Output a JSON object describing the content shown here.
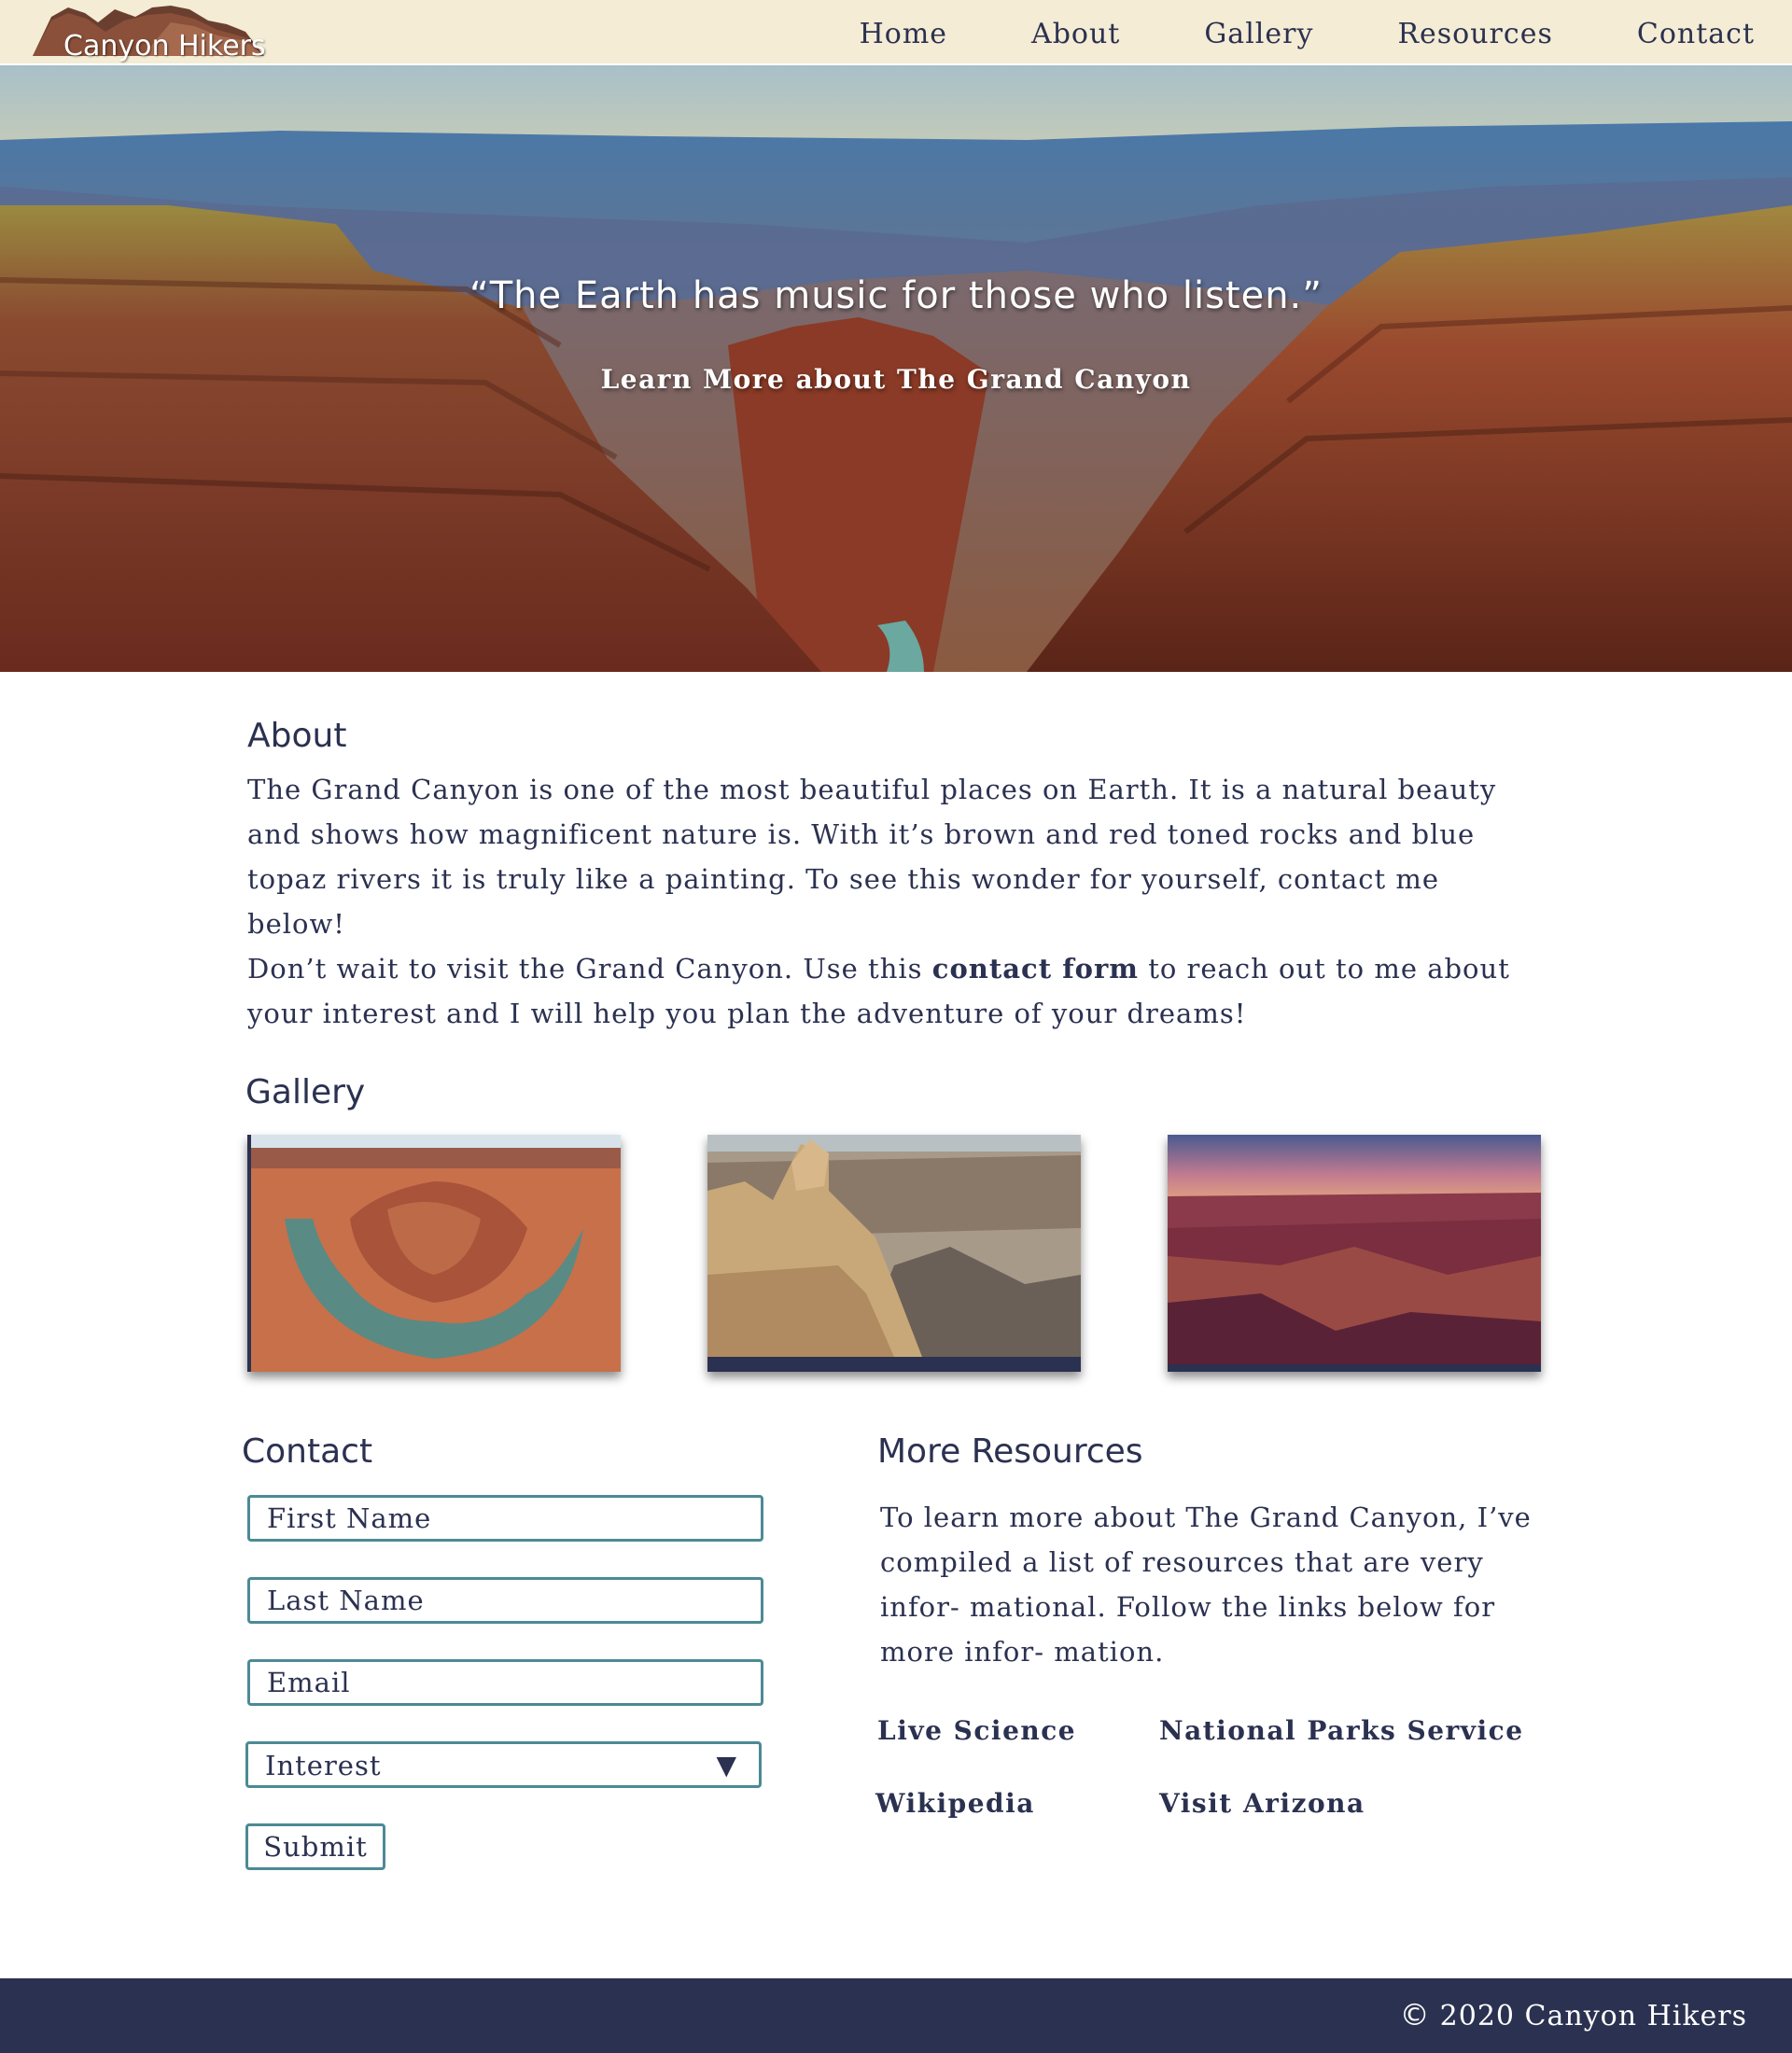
{
  "header": {
    "logo_text": "Canyon Hikers",
    "nav": [
      "Home",
      "About",
      "Gallery",
      "Resources",
      "Contact"
    ]
  },
  "hero": {
    "quote": "“The Earth has music for those who listen.”",
    "link": "Learn More about The Grand Canyon"
  },
  "about": {
    "title": "About",
    "p1": "The Grand Canyon is one of the most beautiful places on Earth. It is a natural beauty and shows how magnificent nature is. With it’s brown and red toned rocks and blue topaz rivers it is truly like a painting. To see this wonder for yourself, contact me below!",
    "p2_before": "Don’t wait to visit the Grand Canyon. Use this ",
    "p2_bold": "contact form",
    "p2_after": " to reach out to me about your interest and I will help you plan the adventure of your dreams!"
  },
  "gallery": {
    "title": "Gallery",
    "images": [
      "horseshoe-bend-photo",
      "rock-formation-photo",
      "sunset-canyon-photo"
    ]
  },
  "contact": {
    "title": "Contact",
    "first_name_placeholder": "First Name",
    "last_name_placeholder": "Last Name",
    "email_placeholder": "Email",
    "interest_label": "Interest",
    "interest_arrow": "▼",
    "submit_label": "Submit"
  },
  "resources": {
    "title": "More Resources",
    "text": "To learn more about The Grand Canyon, I’ve compiled a list of resources that are very infor- mational. Follow the links below for more infor- mation.",
    "links": [
      "Live Science",
      "National Parks Service",
      "Wikipedia",
      "Visit Arizona"
    ]
  },
  "footer": {
    "copyright_icon": "©",
    "copyright": "2020 Canyon Hikers"
  },
  "colors": {
    "navy": "#2b3150",
    "header_bg": "#f4ecd4",
    "input_border": "#4c8a94"
  }
}
